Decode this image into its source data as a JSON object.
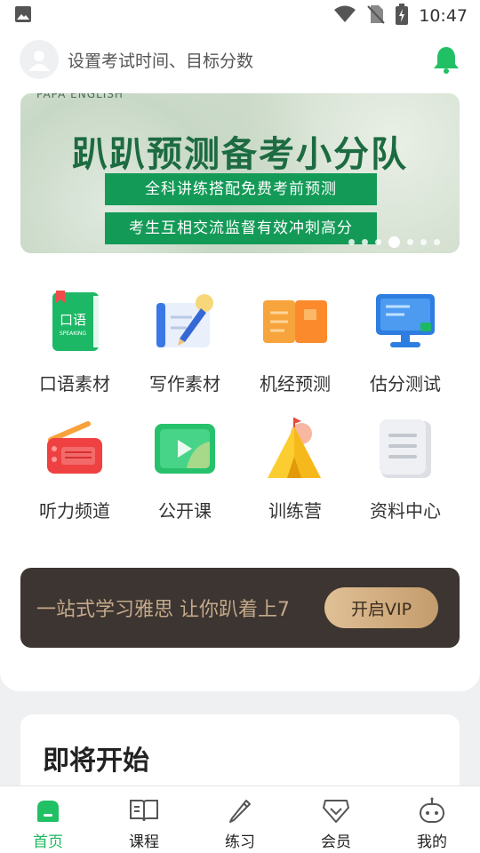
{
  "status_bar": {
    "time": "10:47"
  },
  "header": {
    "prompt": "设置考试时间、目标分数"
  },
  "banner": {
    "brand": "PAPA ENGLISH",
    "title": "趴趴预测备考小分队",
    "line1": "全科讲练搭配免费考前预测",
    "line2": "考生互相交流监督有效冲刺高分",
    "active_dot": 4
  },
  "grid": {
    "items": [
      {
        "label": "口语素材",
        "icon": "speaking-book-icon",
        "icon_text": "口语",
        "icon_subtext": "SPEAKING"
      },
      {
        "label": "写作素材",
        "icon": "writing-notebook-icon"
      },
      {
        "label": "机经预测",
        "icon": "open-book-icon"
      },
      {
        "label": "估分测试",
        "icon": "monitor-icon"
      },
      {
        "label": "听力频道",
        "icon": "radio-icon"
      },
      {
        "label": "公开课",
        "icon": "video-play-icon"
      },
      {
        "label": "训练营",
        "icon": "tent-icon"
      },
      {
        "label": "资料中心",
        "icon": "document-icon"
      }
    ]
  },
  "vip": {
    "text": "一站式学习雅思 让你趴着上7",
    "button": "开启VIP"
  },
  "upcoming": {
    "title": "即将开始"
  },
  "tabbar": {
    "active": "首页",
    "items": [
      {
        "label": "首页",
        "icon": "home-icon"
      },
      {
        "label": "课程",
        "icon": "book-icon"
      },
      {
        "label": "练习",
        "icon": "pencil-icon"
      },
      {
        "label": "会员",
        "icon": "diamond-icon"
      },
      {
        "label": "我的",
        "icon": "robot-icon"
      }
    ]
  },
  "colors": {
    "accent": "#1fb860",
    "banner_green": "#139a57",
    "vip_bg": "#3c3531",
    "vip_gold": "#c4a98a"
  }
}
